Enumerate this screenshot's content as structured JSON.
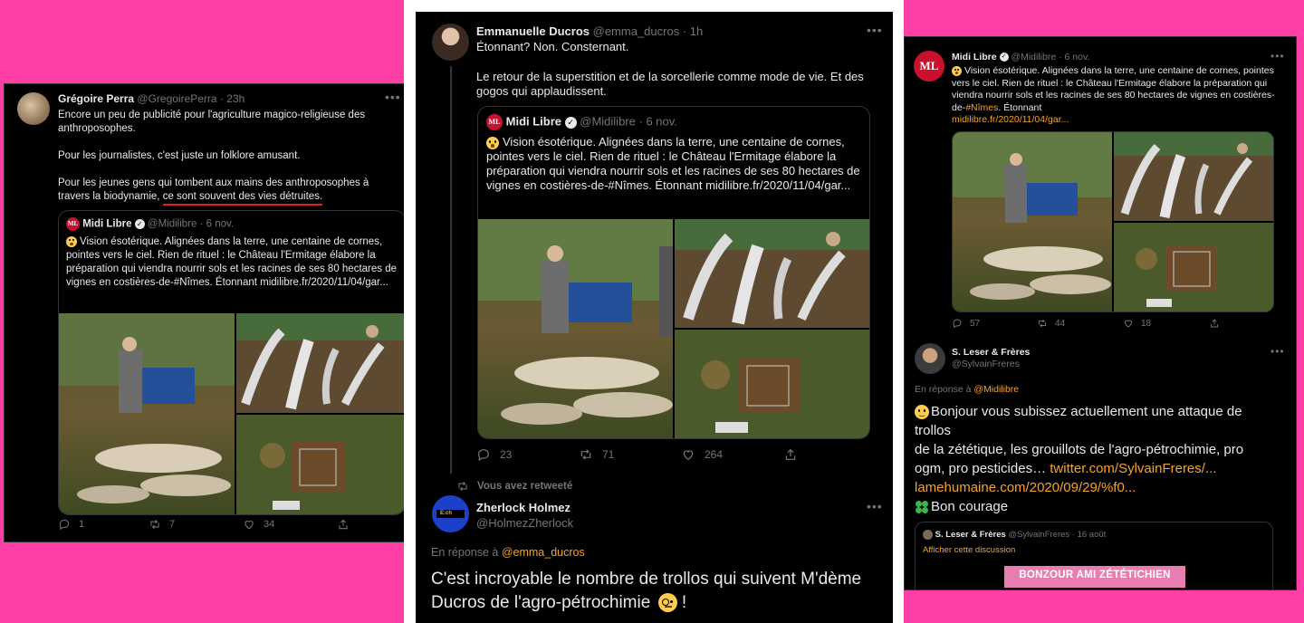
{
  "left": {
    "author_name": "Grégoire Perra",
    "author_handle": "@GregoirePerra",
    "time": "· 23h",
    "text_p1": "Encore un peu de publicité pour l'agriculture magico-religieuse des anthroposophes.",
    "text_p2": "Pour les journalistes, c'est juste un folklore amusant.",
    "text_p3a": "Pour les jeunes gens qui tombent aux mains des anthroposophes à travers la biodynamie, ",
    "text_p3b": "ce sont souvent des vies détruites.",
    "quote": {
      "name": "Midi Libre",
      "handle": "@Midilibre",
      "date": "· 6 nov.",
      "text": "Vision ésotérique. Alignées dans la terre, une centaine de cornes, pointes vers le ciel. Rien de rituel : le Château l'Ermitage élabore la préparation qui viendra nourrir sols et les racines de ses 80 hectares de vignes en costières-de-#Nîmes. Étonnant midilibre.fr/2020/11/04/gar..."
    },
    "stats": {
      "replies": "1",
      "retweets": "7",
      "likes": "34"
    }
  },
  "middle": {
    "author_name": "Emmanuelle Ducros",
    "author_handle": "@emma_ducros",
    "time": "· 1h",
    "text_p1": "Étonnant? Non. Consternant.",
    "text_p2": "Le retour de la superstition et de la sorcellerie comme mode de vie. Et des gogos qui applaudissent.",
    "quote": {
      "logo": "ML",
      "name": "Midi Libre",
      "handle": "@Midilibre",
      "date": "· 6 nov.",
      "text": "Vision ésotérique. Alignées dans la terre, une centaine de cornes, pointes vers le ciel. Rien de rituel : le Château l'Ermitage élabore la préparation qui viendra nourrir sols et les racines de ses 80 hectares de vignes en costières-de-#Nîmes. Étonnant midilibre.fr/2020/11/04/gar..."
    },
    "stats": {
      "replies": "23",
      "retweets": "71",
      "likes": "264"
    },
    "retweet_label": "Vous avez retweeté",
    "reply": {
      "name": "Zherlock Holmez",
      "handle": "@HolmezZherlock",
      "in_reply_prefix": "En réponse à ",
      "in_reply_handle": "@emma_ducros",
      "text": "C'est incroyable le nombre de trollos qui suivent M'dème Ducros de l'agro-pétrochimie",
      "text_end": " !"
    }
  },
  "right": {
    "name": "Midi Libre",
    "handle": "@Midilibre",
    "date": "· 6 nov.",
    "logo": "ML",
    "text": "Vision ésotérique. Alignées dans la terre, une centaine de cornes, pointes vers le ciel. Rien de rituel : le Château l'Ermitage élabore la préparation qui viendra nourrir sols et les racines de ses 80 hectares de vignes en costières-de-",
    "hashtag": "#Nîmes",
    "text_end": ". Étonnant",
    "link": "midilibre.fr/2020/11/04/gar...",
    "stats": {
      "replies": "57",
      "retweets": "44",
      "likes": "18"
    },
    "reply": {
      "name": "S. Leser & Frères",
      "handle": "@SylvainFreres",
      "in_reply_prefix": "En réponse à ",
      "in_reply_handle": "@Midilibre",
      "line1": "Bonjour vous subissez actuellement une attaque de trollos",
      "line2": "de la zététique, les grouillots de l'agro-pétrochimie, pro ogm, pro pesticides… ",
      "link1": "twitter.com/SylvainFreres/...",
      "link2": "lamehumaine.com/2020/09/29/%f0...",
      "line3": "Bon courage",
      "quote_name": "S. Leser & Frères",
      "quote_handle": "@SylvainFreres",
      "quote_date": "· 16 août",
      "show_thread": "Afficher cette discussion",
      "banner": "BONZOUR AMI ZÉTÉTICHIEN"
    }
  },
  "colors": {
    "background": "#ff3fa5",
    "accent_link": "#f7a22b",
    "underline": "#e0201b",
    "midi_libre_red": "#c9102d"
  }
}
